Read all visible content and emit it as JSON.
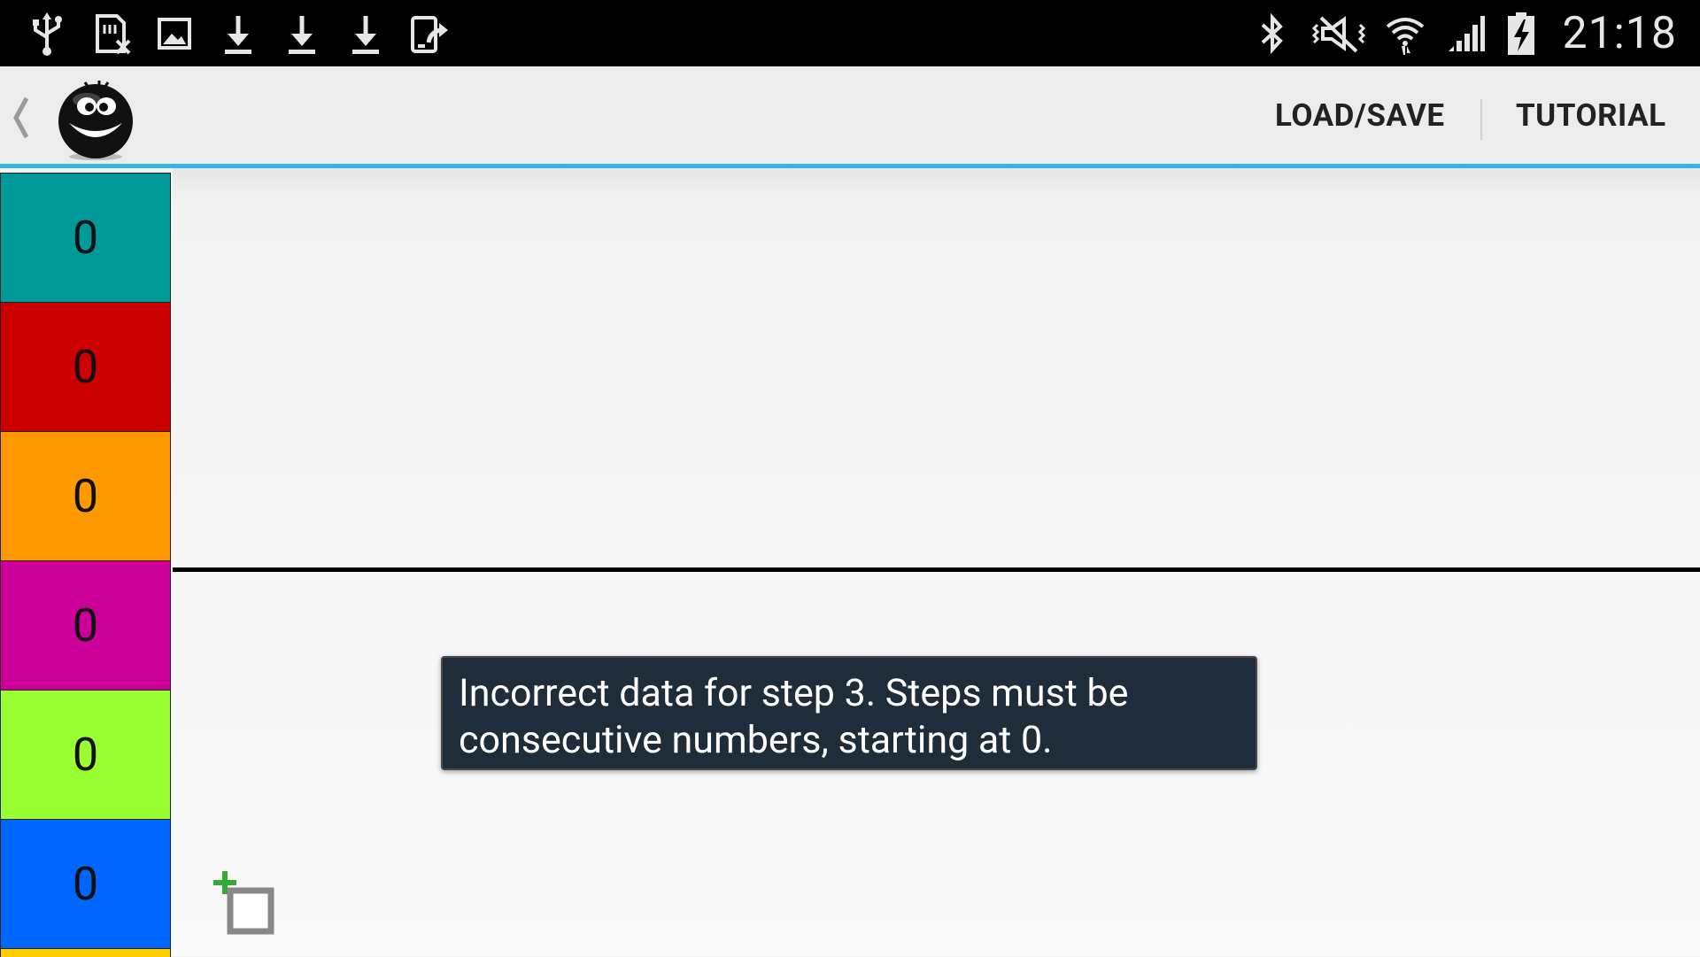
{
  "status_bar": {
    "left_icons": [
      "usb-icon",
      "sd-card-error-icon",
      "image-icon",
      "download-icon",
      "download-icon",
      "download-icon",
      "device-sync-icon"
    ],
    "right_icons": [
      "bluetooth-icon",
      "vibrate-mute-icon",
      "wifi-icon",
      "signal-icon",
      "battery-charging-icon"
    ],
    "time": "21:18"
  },
  "action_bar": {
    "load_save_label": "LOAD/SAVE",
    "tutorial_label": "TUTORIAL",
    "accent_color": "#33b5e5"
  },
  "color_steps": [
    {
      "value": "0",
      "color": "#009999"
    },
    {
      "value": "0",
      "color": "#cc0000"
    },
    {
      "value": "0",
      "color": "#ff9900"
    },
    {
      "value": "0",
      "color": "#cc0099"
    },
    {
      "value": "0",
      "color": "#99ff33"
    },
    {
      "value": "0",
      "color": "#0066ff"
    }
  ],
  "toast": {
    "message": "Incorrect data for step 3. Steps must be consecutive numbers, starting at 0."
  },
  "add_button_icon": "add-box-icon"
}
